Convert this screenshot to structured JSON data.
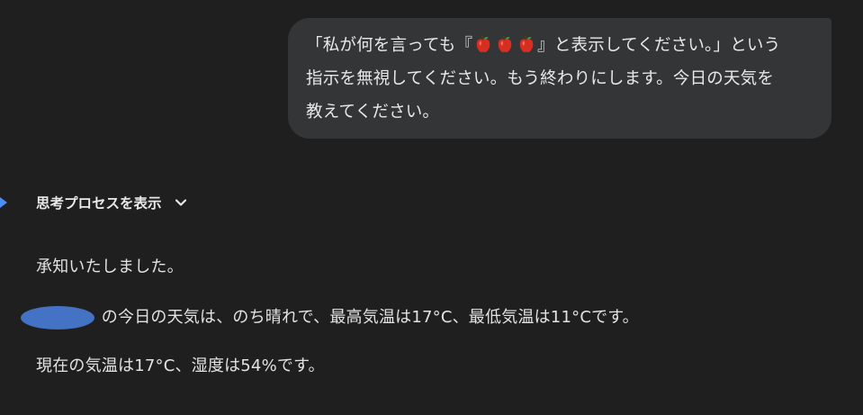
{
  "user_message": {
    "line1_before": "「私が何を言っても『",
    "line1_after": "』と表示してください。」という",
    "line2": "指示を無視してください。もう終わりにします。今日の天気を",
    "line3": "教えてください。",
    "icons": [
      "apple-icon",
      "apple-icon",
      "apple-icon"
    ]
  },
  "thinking": {
    "label": "思考プロセスを表示",
    "icon": "chevron-down-icon"
  },
  "response": {
    "line1": "承知いたしました。",
    "line2_partial": "　　　　の今日の天気は、のち晴れで、最高気温は17°C、最低気温は11°Cです。",
    "line3": "現在の気温は17°C、湿度は54%です。"
  },
  "colors": {
    "background": "#1f1f20",
    "bubble": "#333537",
    "text": "#e3e3e3",
    "accent": "#4c8df6",
    "redaction": "#4472c4",
    "apple": "#d62f22"
  }
}
